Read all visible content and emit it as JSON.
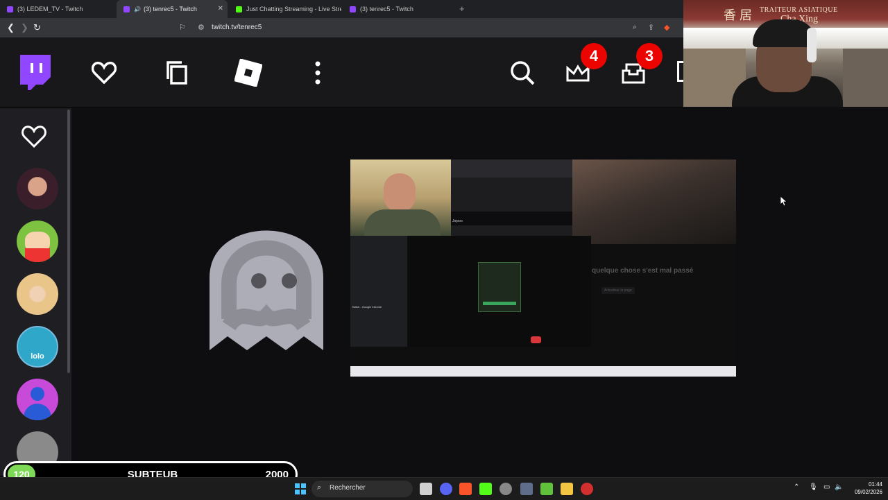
{
  "browser": {
    "tabs": [
      {
        "label": "(3) LEDEM_TV - Twitch",
        "active": false,
        "favicon_color": "#9146ff"
      },
      {
        "label": "(3) tenrec5 - Twitch",
        "active": true,
        "favicon_color": "#9146ff"
      },
      {
        "label": "Just Chatting Streaming - Live Stream",
        "active": false,
        "favicon_color": "#53fc18"
      },
      {
        "label": "(3) tenrec5 - Twitch",
        "active": false,
        "favicon_color": "#9146ff"
      }
    ],
    "new_tab": "+",
    "url": "twitch.tv/tenrec5"
  },
  "twitch": {
    "brand_color": "#9146ff",
    "notifications_count": "4",
    "inbox_count": "3"
  },
  "webcam": {
    "sign_title": "TRAITEUR ASIATIQUE",
    "sign_name": "Cha Xing",
    "sign_chinese": "香 居"
  },
  "sidebar": {
    "channels": [
      {
        "name": "followed-channel-1",
        "color": "#7a3f6a"
      },
      {
        "name": "followed-channel-2",
        "color": "#7ec242"
      },
      {
        "name": "followed-channel-3",
        "color": "#d9b58a"
      },
      {
        "name": "followed-channel-4",
        "color": "#2fa7c9",
        "text": "lolo"
      },
      {
        "name": "followed-channel-5",
        "color": "#c74ad9"
      },
      {
        "name": "followed-channel-6",
        "color": "#8a8a8a"
      }
    ]
  },
  "video": {
    "error_text": "quelque chose s'est mal passé",
    "retry_text": "Actualiser la page",
    "discord_channel": "Twitch - Google Chrome",
    "user": "Jojooo"
  },
  "counter": {
    "current": "120",
    "label": "SUBTEUB",
    "goal": "2000",
    "accent": "#7ed957"
  },
  "taskbar": {
    "search_placeholder": "Rechercher",
    "time": "01:44",
    "date": "09/02/2026"
  }
}
